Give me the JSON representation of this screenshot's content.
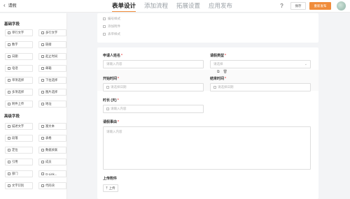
{
  "header": {
    "back_label": "请假",
    "tabs": [
      {
        "label": "表单设计",
        "active": true
      },
      {
        "label": "添加流程",
        "active": false
      },
      {
        "label": "拓展设置",
        "active": false
      },
      {
        "label": "应用发布",
        "active": false
      }
    ],
    "help_icon": "?",
    "save_label": "保存",
    "publish_label": "重新发布"
  },
  "sidebar": {
    "basic_title": "基础字段",
    "basic_items": [
      "单行文字",
      "多行文字",
      "数字",
      "链接",
      "日期",
      "起止时间",
      "电话",
      "邮箱",
      "单项选择",
      "下拉选择",
      "多项选择",
      "图片选择",
      "附件上传",
      "地址"
    ],
    "advanced_title": "高级字段",
    "advanced_items": [
      "描述文字",
      "富文本",
      "段落",
      "表格",
      "定位",
      "数据关联",
      "引用",
      "成员",
      "部门",
      "G-Link...",
      "文字识别",
      "代码块"
    ]
  },
  "top_card": {
    "lines": [
      "编号样式",
      "添加附件",
      "表单样式"
    ]
  },
  "form": {
    "applicant": {
      "label": "申请人姓名",
      "placeholder": "请输入内容"
    },
    "leave_type": {
      "label": "请假类型",
      "placeholder": "请选择"
    },
    "start_time": {
      "label": "开始时间",
      "placeholder": "请选择日期"
    },
    "end_time": {
      "label": "结束时间",
      "placeholder": "请选择日期"
    },
    "duration": {
      "label": "时长 (天)",
      "placeholder": "请输入内容"
    },
    "reason": {
      "label": "请假事由",
      "placeholder": "请输入内容"
    },
    "attachment": {
      "label": "上传附件",
      "button": "上传"
    }
  },
  "colors": {
    "accent": "#f08c3a",
    "required": "#ee5555"
  }
}
